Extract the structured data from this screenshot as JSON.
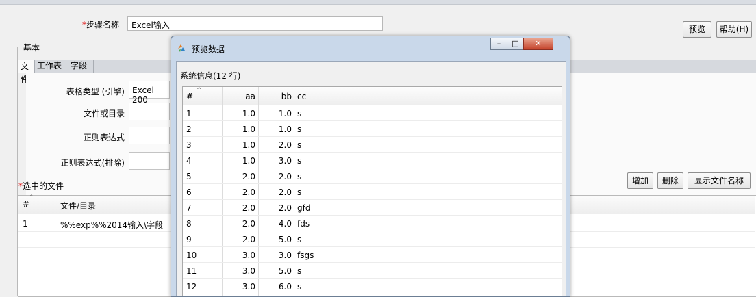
{
  "step": {
    "label": "步骤名称",
    "value": "Excel输入"
  },
  "top_buttons": {
    "preview": "预览",
    "help": "帮助(H)"
  },
  "group_title": "基本",
  "tabs": [
    "文件",
    "工作表",
    "字段"
  ],
  "fields": [
    {
      "label": "表格类型 (引擎)",
      "value": "Excel 200"
    },
    {
      "label": "文件或目录",
      "value": ""
    },
    {
      "label": "正则表达式",
      "value": ""
    },
    {
      "label": "正则表达式(排除)",
      "value": ""
    }
  ],
  "selected_files": {
    "title": "选中的文件",
    "buttons": [
      "增加",
      "删除",
      "显示文件名称"
    ],
    "headers": [
      "#",
      "文件/目录"
    ],
    "rows": [
      {
        "n": "1",
        "path": "%%exp%%2014输入\\字段"
      }
    ]
  },
  "dialog": {
    "title": "预览数据",
    "info": "系统信息(12 行)",
    "headers": [
      "#",
      "aa",
      "bb",
      "cc"
    ],
    "rows": [
      [
        "1",
        "1.0",
        "1.0",
        "s"
      ],
      [
        "2",
        "1.0",
        "1.0",
        "s"
      ],
      [
        "3",
        "1.0",
        "2.0",
        "s"
      ],
      [
        "4",
        "1.0",
        "3.0",
        "s"
      ],
      [
        "5",
        "2.0",
        "2.0",
        "s"
      ],
      [
        "6",
        "2.0",
        "2.0",
        "s"
      ],
      [
        "7",
        "2.0",
        "2.0",
        "gfd"
      ],
      [
        "8",
        "2.0",
        "4.0",
        "fds"
      ],
      [
        "9",
        "2.0",
        "5.0",
        "s"
      ],
      [
        "10",
        "3.0",
        "3.0",
        "fsgs"
      ],
      [
        "11",
        "3.0",
        "5.0",
        "s"
      ],
      [
        "12",
        "3.0",
        "6.0",
        "s"
      ]
    ]
  }
}
